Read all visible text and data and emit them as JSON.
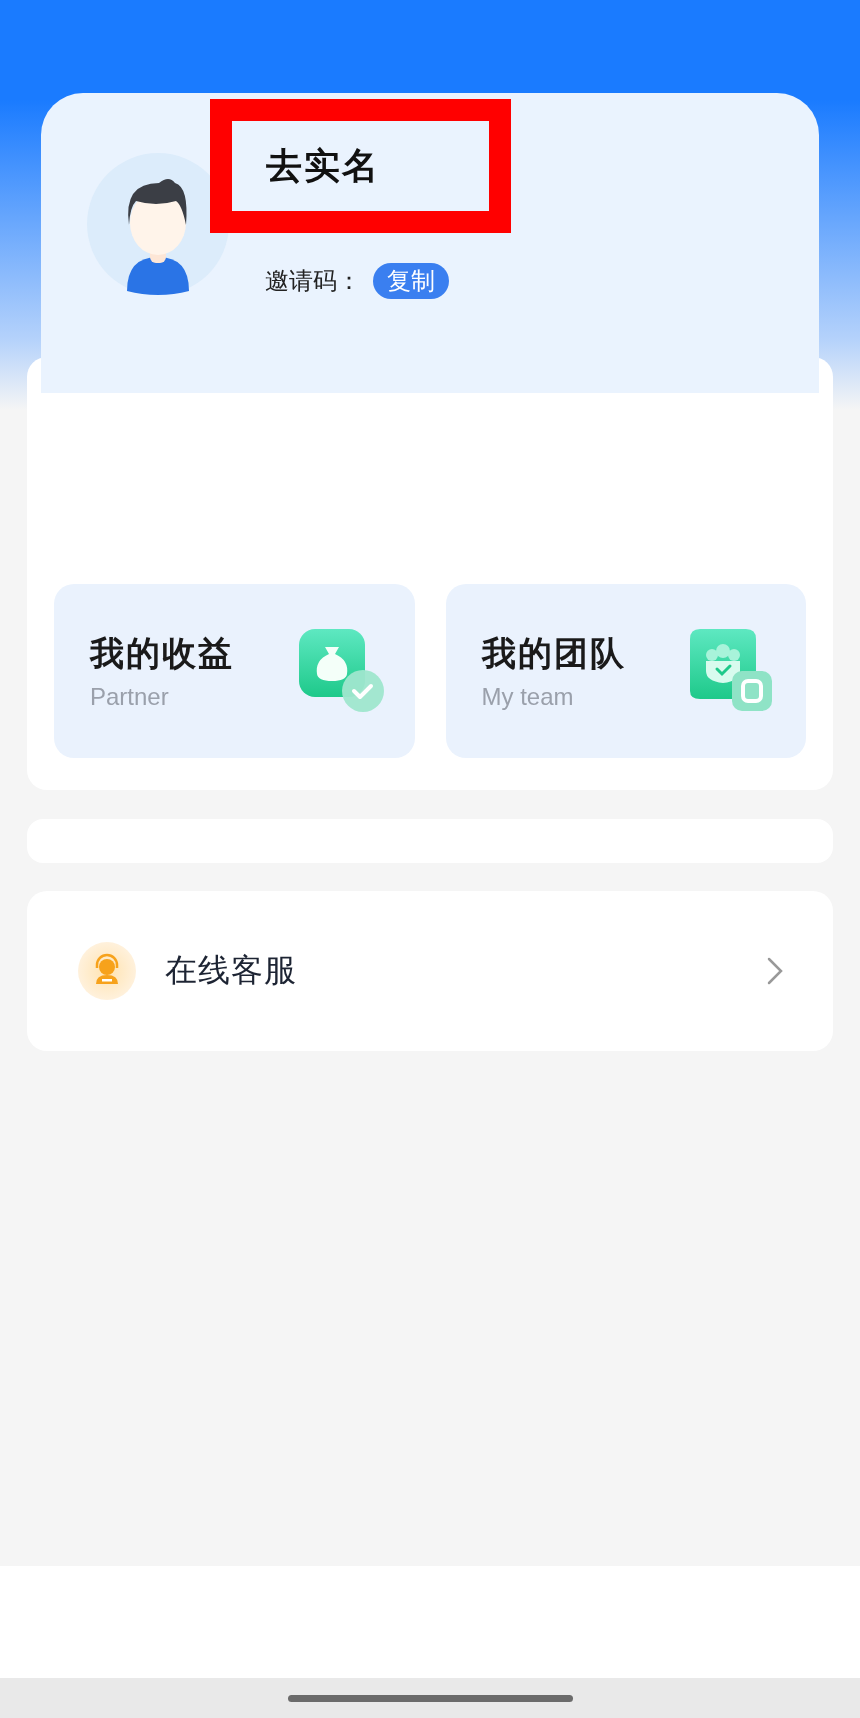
{
  "profile": {
    "real_name_action": "去实名",
    "invite_label": "邀请码：",
    "copy_button": "复制"
  },
  "features": [
    {
      "title": "我的收益",
      "subtitle": "Partner",
      "kind": "earnings"
    },
    {
      "title": "我的团队",
      "subtitle": "My team",
      "kind": "team"
    }
  ],
  "menu": [
    {
      "label": "在线客服",
      "kind": "support"
    }
  ]
}
